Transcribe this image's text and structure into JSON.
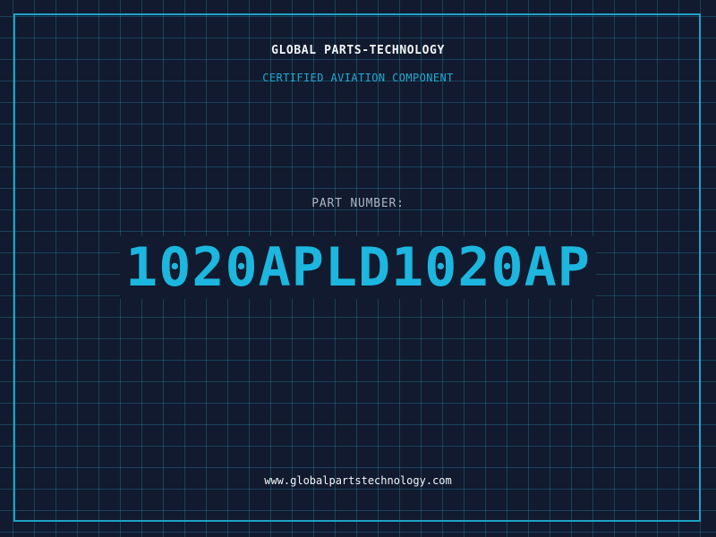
{
  "header": {
    "company_name": "GLOBAL PARTS-TECHNOLOGY",
    "subtitle": "CERTIFIED AVIATION COMPONENT"
  },
  "part": {
    "label": "PART NUMBER:",
    "number": "1020APLD1020AP"
  },
  "footer": {
    "website": "www.globalpartstechnology.com"
  },
  "colors": {
    "background": "#111a2e",
    "grid_line": "#288caa",
    "frame": "#1fa2c4",
    "accent": "#1cb6df",
    "subtitle": "#21aad2",
    "label": "#a9b4c4",
    "text": "#f2f5f8"
  }
}
